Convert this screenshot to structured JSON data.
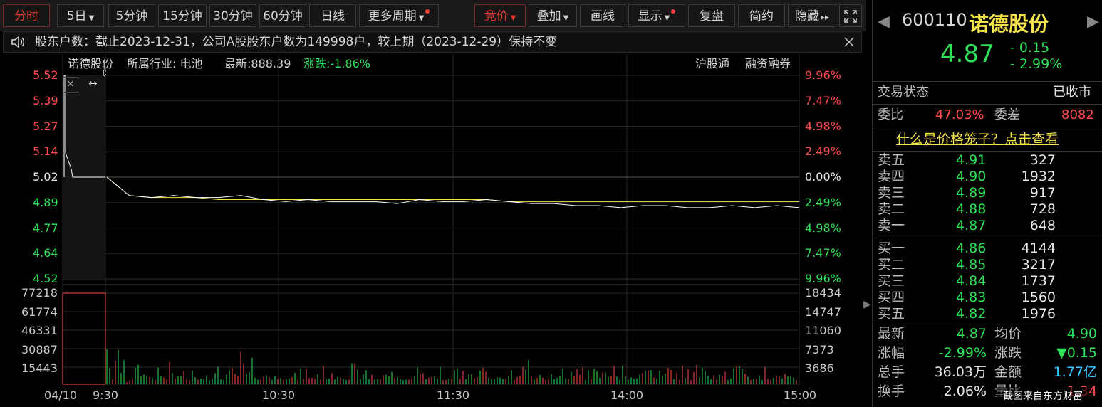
{
  "toolbar": {
    "fenshi": "分时",
    "day5": "5日",
    "min5": "5分钟",
    "min15": "15分钟",
    "min30": "30分钟",
    "min60": "60分钟",
    "rixian": "日线",
    "more": "更多周期",
    "jingjia": "竞价",
    "diejia": "叠加",
    "huaxian": "画线",
    "xianshi": "显示",
    "fupan": "复盘",
    "jianyue": "简约",
    "yincang": "隐藏"
  },
  "notice": {
    "text": "股东户数：截止2023-12-31，公司A股股东户数为149998户，较上期（2023-12-29）保持不变"
  },
  "chart_info": {
    "name": "诺德股份",
    "industry": "所属行业: 电池",
    "latest": "最新:888.39",
    "change": "涨跌:-1.86%",
    "tag1": "沪股通",
    "tag2": "融资融券"
  },
  "chart_data": {
    "type": "line",
    "price_ticks": [
      "5.52",
      "5.39",
      "5.27",
      "5.14",
      "5.02",
      "4.89",
      "4.77",
      "4.64",
      "4.52"
    ],
    "pct_ticks": [
      "9.96%",
      "7.47%",
      "4.98%",
      "2.49%",
      "0.00%",
      "2.49%",
      "4.98%",
      "7.47%",
      "9.96%"
    ],
    "vol_ticks_left": [
      "77218",
      "61774",
      "46331",
      "30887",
      "15443"
    ],
    "vol_ticks_right": [
      "18434",
      "14747",
      "11060",
      "7373",
      "3686"
    ],
    "time_ticks": [
      "04/10",
      "9:30",
      "10:30",
      "11:30",
      "14:00",
      "15:00"
    ],
    "ylim": [
      4.52,
      5.52
    ],
    "prev_close": 5.02,
    "price": [
      5.02,
      4.93,
      4.92,
      4.93,
      4.92,
      4.92,
      4.93,
      4.91,
      4.9,
      4.91,
      4.9,
      4.9,
      4.9,
      4.89,
      4.91,
      4.9,
      4.9,
      4.91,
      4.9,
      4.89,
      4.89,
      4.88,
      4.88,
      4.87,
      4.88,
      4.88,
      4.87,
      4.87,
      4.88,
      4.87,
      4.88,
      4.87
    ],
    "avg": [
      5.02,
      4.93,
      4.92,
      4.92,
      4.92,
      4.91,
      4.91,
      4.91,
      4.91,
      4.91,
      4.91,
      4.91,
      4.91,
      4.91,
      4.91,
      4.91,
      4.91,
      4.91,
      4.9,
      4.9,
      4.9,
      4.9,
      4.9,
      4.9,
      4.9,
      4.9,
      4.9,
      4.9,
      4.9,
      4.9,
      4.9,
      4.9
    ]
  },
  "right": {
    "code": "600110",
    "name": "诺德股份",
    "price": "4.87",
    "chg": "- 0.15",
    "pct": "- 2.99%",
    "status_label": "交易状态",
    "status_value": "已收市",
    "weibi_label": "委比",
    "weibi_value": "47.03%",
    "weicha_label": "委差",
    "weicha_value": "8082",
    "link": "什么是价格笼子？点击查看",
    "sells": [
      {
        "label": "卖五",
        "price": "4.91",
        "vol": "327"
      },
      {
        "label": "卖四",
        "price": "4.90",
        "vol": "1932"
      },
      {
        "label": "卖三",
        "price": "4.89",
        "vol": "917"
      },
      {
        "label": "卖二",
        "price": "4.88",
        "vol": "728"
      },
      {
        "label": "卖一",
        "price": "4.87",
        "vol": "648"
      }
    ],
    "buys": [
      {
        "label": "买一",
        "price": "4.86",
        "vol": "4144"
      },
      {
        "label": "买二",
        "price": "4.85",
        "vol": "3217"
      },
      {
        "label": "买三",
        "price": "4.84",
        "vol": "1737"
      },
      {
        "label": "买四",
        "price": "4.83",
        "vol": "1560"
      },
      {
        "label": "买五",
        "price": "4.82",
        "vol": "1976"
      }
    ],
    "stats": {
      "zuixin_label": "最新",
      "zuixin": "4.87",
      "junjia_label": "均价",
      "junjia": "4.90",
      "zhangfu_label": "涨幅",
      "zhangfu": "-2.99%",
      "zhangdie_label": "涨跌",
      "zhangdie": "▼0.15",
      "zongshou_label": "总手",
      "zongshou": "36.03万",
      "jine_label": "金额",
      "jine": "1.77亿",
      "huanshou_label": "换手",
      "huanshou": "2.06%",
      "liangbi_label": "量比",
      "liangbi": "1.34"
    }
  },
  "watermark": "截图来自东方财富",
  "colors": {
    "up": "#ff4b4b",
    "down": "#2ee05a",
    "avg": "#f4e24a",
    "price": "#ffffff"
  }
}
